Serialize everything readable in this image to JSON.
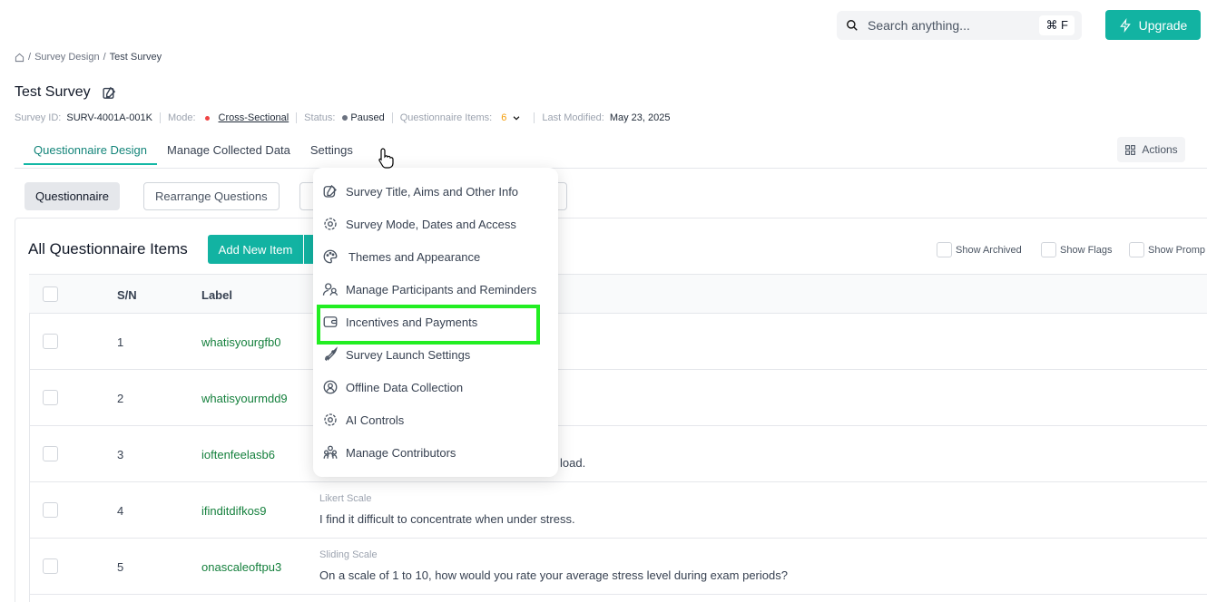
{
  "topbar": {
    "search_placeholder": "Search anything...",
    "search_shortcut": "⌘ F",
    "upgrade_label": "Upgrade",
    "accent": "#12b3a2"
  },
  "breadcrumb": {
    "items": [
      "Survey Design",
      "Test Survey"
    ]
  },
  "page": {
    "title": "Test Survey"
  },
  "meta": {
    "survey_id_label": "Survey ID:",
    "survey_id": "SURV-4001A-001K",
    "mode_label": "Mode:",
    "mode": "Cross-Sectional",
    "status_label": "Status:",
    "status": "Paused",
    "items_label": "Questionnaire Items:",
    "items_count": "6",
    "modified_label": "Last Modified:",
    "modified": "May 23, 2025"
  },
  "tabs": [
    "Questionnaire Design",
    "Manage Collected Data",
    "Settings"
  ],
  "actions_label": "Actions",
  "subtabs": [
    "Questionnaire",
    "Rearrange Questions"
  ],
  "panel": {
    "title": "All Questionnaire Items",
    "add_label": "Add New Item",
    "show_archived": "Show Archived",
    "show_flags": "Show Flags",
    "show_prompts": "Show Promp"
  },
  "table": {
    "headers": [
      "S/N",
      "Label"
    ],
    "rows": [
      {
        "sn": "1",
        "label": "whatisyourgfb0",
        "type": "",
        "question": ""
      },
      {
        "sn": "2",
        "label": "whatisyourmdd9",
        "type": "",
        "question": ""
      },
      {
        "sn": "3",
        "label": "ioftenfeelasb6",
        "type": "",
        "question": "load."
      },
      {
        "sn": "4",
        "label": "ifinditdifkos9",
        "type": "Likert Scale",
        "question": "I find it difficult to concentrate when under stress."
      },
      {
        "sn": "5",
        "label": "onascaleoftpu3",
        "type": "Sliding Scale",
        "question": "On a scale of 1 to 10, how would you rate your average stress level during exam periods?"
      }
    ]
  },
  "settings_menu": {
    "items": [
      {
        "label": "Survey Title, Aims and Other Info",
        "icon": "edit-icon"
      },
      {
        "label": "Survey Mode, Dates and Access",
        "icon": "gear-icon"
      },
      {
        "label": "Themes and Appearance",
        "icon": "palette-icon"
      },
      {
        "label": "Manage Participants and Reminders",
        "icon": "users-icon"
      },
      {
        "label": "Incentives and Payments",
        "icon": "wallet-icon"
      },
      {
        "label": "Survey Launch Settings",
        "icon": "rocket-icon"
      },
      {
        "label": "Offline Data Collection",
        "icon": "user-badge-icon"
      },
      {
        "label": "AI Controls",
        "icon": "gear-icon"
      },
      {
        "label": "Manage Contributors",
        "icon": "team-icon"
      }
    ],
    "highlight_color": "#22ee22"
  }
}
